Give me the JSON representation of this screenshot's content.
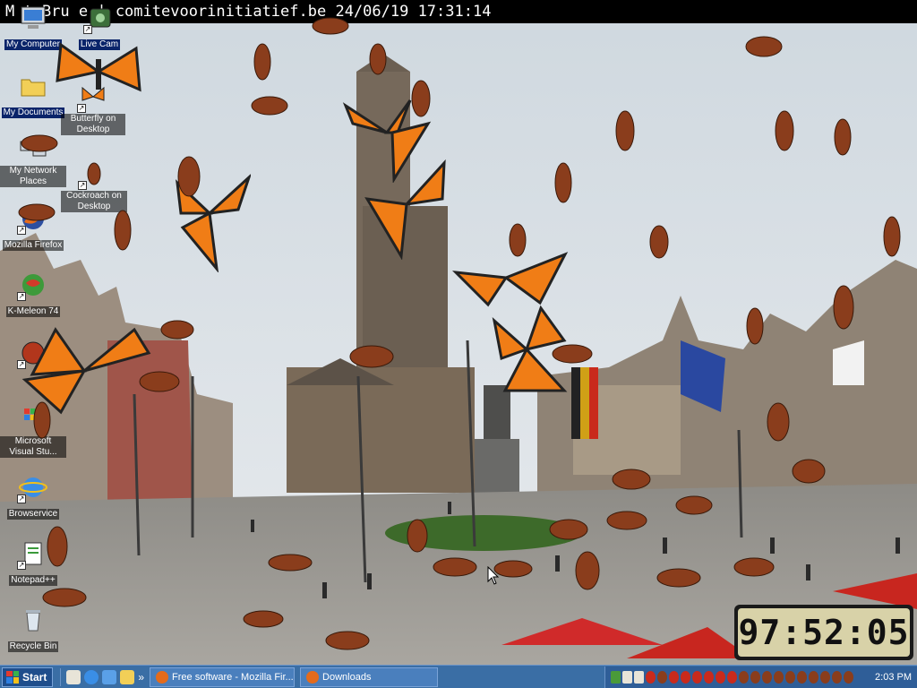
{
  "window": {
    "cam_title": "M t Bru e | comitevoorinitiatief.be 24/06/19 17:31:14"
  },
  "desktop_icons": [
    {
      "label": "My Computer",
      "icon": "computer-icon"
    },
    {
      "label": "Live Cam",
      "icon": "webcam-icon"
    },
    {
      "label": "My Documents",
      "icon": "folder-icon"
    },
    {
      "label": "Butterfly on Desktop",
      "icon": "butterfly-icon"
    },
    {
      "label": "My Network Places",
      "icon": "network-icon"
    },
    {
      "label": "Cockroach on Desktop",
      "icon": "cockroach-icon"
    },
    {
      "label": "Mozilla Firefox",
      "icon": "firefox-icon"
    },
    {
      "label": "K-Meleon 74",
      "icon": "kmeleon-icon"
    },
    {
      "label": "Microsoft Visual Stu...",
      "icon": "visual-studio-icon"
    },
    {
      "label": "Browservice",
      "icon": "ie-icon"
    },
    {
      "label": "Notepad++",
      "icon": "notepad-icon"
    },
    {
      "label": "Recycle Bin",
      "icon": "recycle-bin-icon"
    }
  ],
  "digital_clock": {
    "time": "97:52:05"
  },
  "taskbar": {
    "start_label": "Start",
    "tasks": [
      {
        "label": "Free software - Mozilla Fir...",
        "icon": "firefox-icon"
      },
      {
        "label": "Downloads",
        "icon": "firefox-icon"
      }
    ],
    "tray_time": "2:03 PM"
  },
  "colors": {
    "taskbar": "#3a6ea5",
    "selection_label": "#0a246a",
    "butterfly": "#f07d16",
    "cockroach": "#8a3d1c"
  }
}
